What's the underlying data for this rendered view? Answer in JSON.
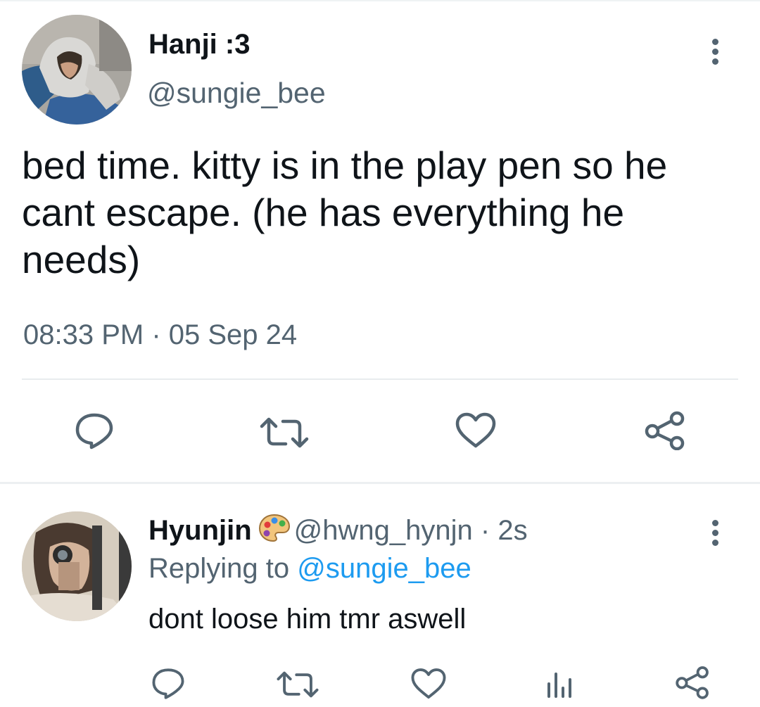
{
  "tweet": {
    "author_name": "Hanji :3",
    "author_handle": "@sungie_bee",
    "text": "bed time. kitty is in the play pen so he cant escape. (he has everything he needs)",
    "time": "08:33 PM",
    "date": "05 Sep 24",
    "meta_separator": " · ",
    "more_icon": "more-vertical-icon",
    "actions": [
      "reply-icon",
      "retweet-icon",
      "like-icon",
      "share-icon"
    ]
  },
  "reply": {
    "author_name": "Hyunjin",
    "author_emoji": "artist-palette-icon",
    "author_handle": "@hwng_hynjn",
    "separator": " · ",
    "time": "2s",
    "replying_prefix": "Replying to ",
    "replying_to": "@sungie_bee",
    "text": "dont loose him tmr aswell",
    "more_icon": "more-vertical-icon",
    "actions": [
      "reply-icon",
      "retweet-icon",
      "like-icon",
      "analytics-icon",
      "share-icon"
    ]
  },
  "colors": {
    "text_primary": "#0f1419",
    "text_secondary": "#536471",
    "link": "#1d9bf0",
    "divider": "#e8ecee"
  }
}
